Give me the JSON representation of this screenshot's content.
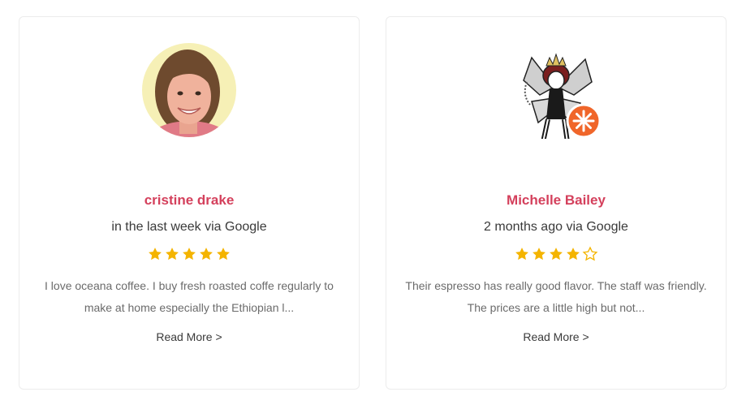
{
  "reviews": [
    {
      "name": "cristine drake",
      "meta": "in the last week via Google",
      "rating": 5,
      "text": "I love oceana coffee. I buy fresh roasted coffe regularly to make at home especially the Ethiopian l...",
      "read_more": "Read More >",
      "avatar_icon": "profile-photo-icon"
    },
    {
      "name": "Michelle Bailey",
      "meta": "2 months ago via Google",
      "rating": 4,
      "text": "Their espresso has really good flavor. The staff was friendly. The prices are a little high but not...",
      "read_more": "Read More >",
      "avatar_icon": "fairy-avatar-icon",
      "badge_icon": "local-guide-badge-icon"
    }
  ],
  "colors": {
    "name": "#d4405c",
    "star": "#f4b400",
    "badge": "#f0662a",
    "border": "#ececec"
  }
}
